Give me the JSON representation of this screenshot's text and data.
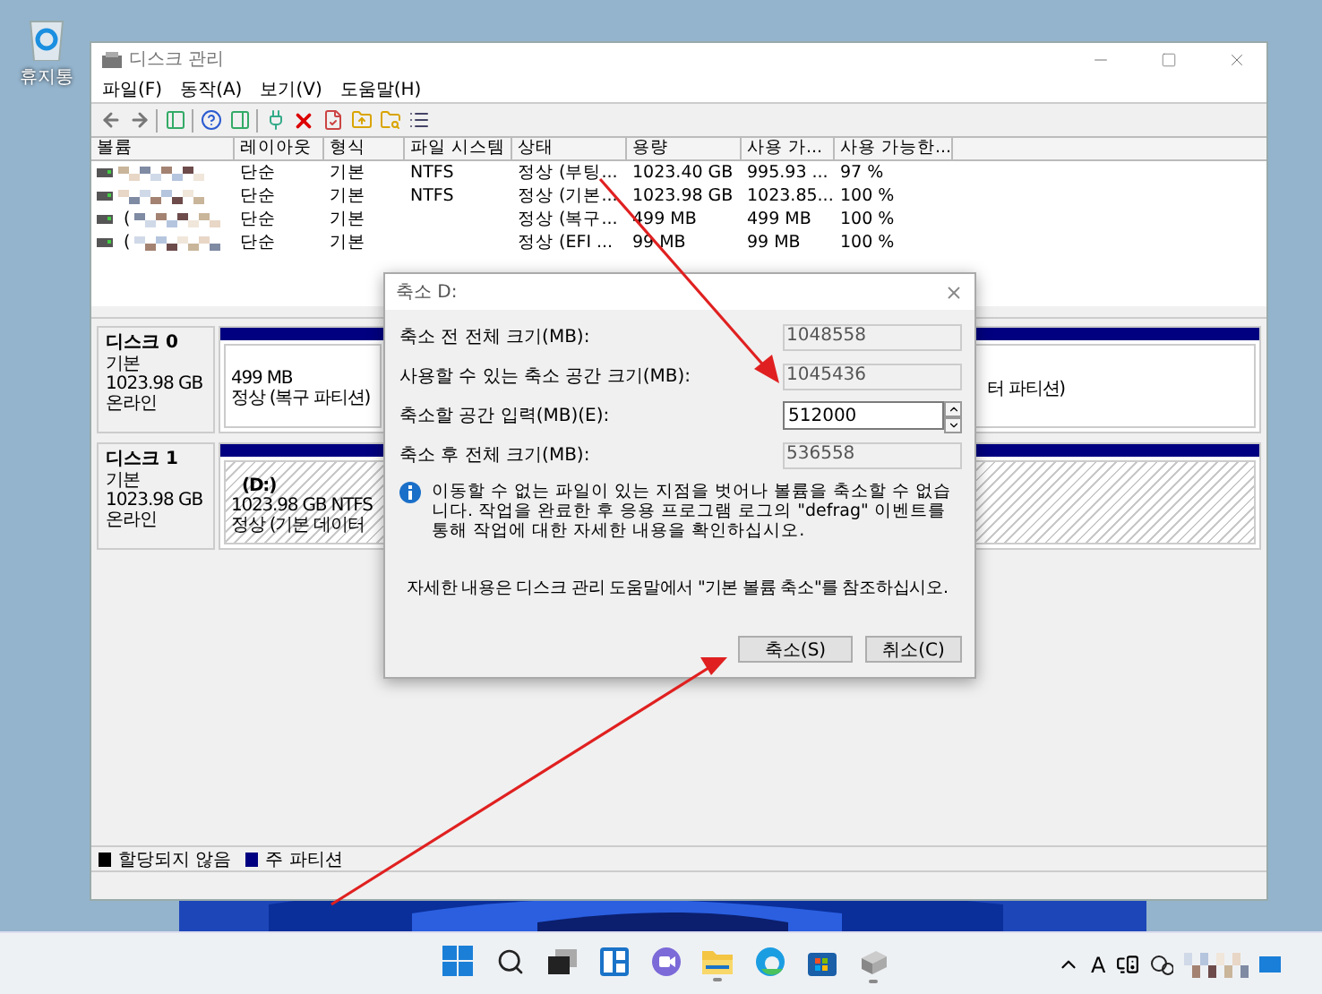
{
  "desktop_icons": [
    {
      "label": "휴지통"
    }
  ],
  "window": {
    "title": "디스크 관리"
  },
  "menu": [
    "파일(F)",
    "동작(A)",
    "보기(V)",
    "도움말(H)"
  ],
  "volume_table": {
    "columns": [
      "볼륨",
      "레이아웃",
      "형식",
      "파일 시스템",
      "상태",
      "용량",
      "사용 가...",
      "사용 가능한..."
    ],
    "rows": [
      {
        "layout": "단순",
        "type": "기본",
        "fs": "NTFS",
        "status": "정상 (부팅...",
        "capacity": "1023.40 GB",
        "free": "995.93 ...",
        "percent": "97 %"
      },
      {
        "layout": "단순",
        "type": "기본",
        "fs": "NTFS",
        "status": "정상 (기본...",
        "capacity": "1023.98 GB",
        "free": "1023.85...",
        "percent": "100 %"
      },
      {
        "volume": "(",
        "layout": "단순",
        "type": "기본",
        "status": "정상 (복구...",
        "capacity": "499 MB",
        "free": "499 MB",
        "percent": "100 %"
      },
      {
        "volume": "(",
        "layout": "단순",
        "type": "기본",
        "status": "정상 (EFI ...",
        "capacity": "99 MB",
        "free": "99 MB",
        "percent": "100 %"
      }
    ]
  },
  "disks": [
    {
      "name": "디스크 0",
      "type": "기본",
      "size": "1023.98 GB",
      "status": "온라인",
      "partitions": [
        {
          "lines": [
            "499 MB",
            "정상 (복구 파티션)"
          ],
          "selected": false
        },
        {
          "lines": [
            "터 파티션)"
          ],
          "selected": false
        }
      ]
    },
    {
      "name": "디스크 1",
      "type": "기본",
      "size": "1023.98 GB",
      "status": "온라인",
      "partitions": [
        {
          "lines": [
            "(D:)",
            "1023.98 GB NTFS",
            "정상 (기본 데이터"
          ],
          "selected": true
        }
      ]
    }
  ],
  "legend": [
    {
      "label": "할당되지 않음",
      "color": "#000000"
    },
    {
      "label": "주 파티션",
      "color": "#000080"
    }
  ],
  "dialog": {
    "title": "축소 D:",
    "fields": [
      {
        "label": "축소 전 전체 크기(MB):",
        "value": "1048558",
        "kind": "readonly"
      },
      {
        "label": "사용할 수 있는 축소 공간 크기(MB):",
        "value": "1045436",
        "kind": "readonly"
      },
      {
        "label": "축소할 공간 입력(MB)(E):",
        "value": "512000",
        "kind": "spin"
      },
      {
        "label": "축소 후 전체 크기(MB):",
        "value": "536558",
        "kind": "readonly"
      }
    ],
    "info": "이동할 수 없는 파일이 있는 지점을 벗어나 볼륨을 축소할 수 없습니다. 작업을 완료한 후 응용 프로그램 로그의 \"defrag\" 이벤트를 통해 작업에 대한 자세한 내용을 확인하십시오.",
    "help": "자세한 내용은 디스크 관리 도움말에서 \"기본 볼륨 축소\"를 참조하십시오.",
    "buttons": [
      "축소(S)",
      "취소(C)"
    ]
  },
  "taskbar": {
    "apps": [
      {
        "kind": "start",
        "running": false
      },
      {
        "kind": "search",
        "running": false
      },
      {
        "kind": "taskview",
        "running": false
      },
      {
        "kind": "widgets",
        "running": false
      },
      {
        "kind": "chat",
        "running": false
      },
      {
        "kind": "explorer",
        "running": true
      },
      {
        "kind": "edge",
        "running": false
      },
      {
        "kind": "store",
        "running": false
      },
      {
        "kind": "diskmgmt",
        "running": true
      }
    ],
    "input_indicator": "A"
  }
}
